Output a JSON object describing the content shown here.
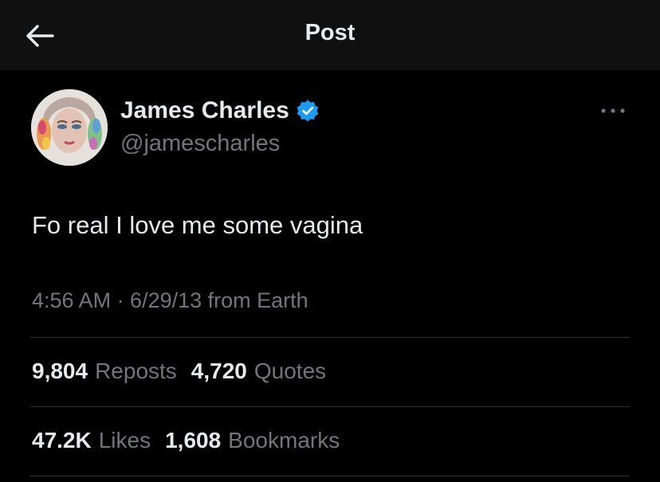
{
  "header": {
    "title": "Post",
    "back_icon": "arrow-left-icon"
  },
  "author": {
    "name": "James Charles",
    "handle": "@jamescharles",
    "verified_color": "#1d9bf0"
  },
  "post": {
    "text": "Fo real I love me some vagina",
    "meta": "4:56 AM · 6/29/13 from Earth"
  },
  "stats": {
    "row1": [
      {
        "count": "9,804",
        "label": "Reposts"
      },
      {
        "count": "4,720",
        "label": "Quotes"
      }
    ],
    "row2": [
      {
        "count": "47.2K",
        "label": "Likes"
      },
      {
        "count": "1,608",
        "label": "Bookmarks"
      }
    ]
  }
}
